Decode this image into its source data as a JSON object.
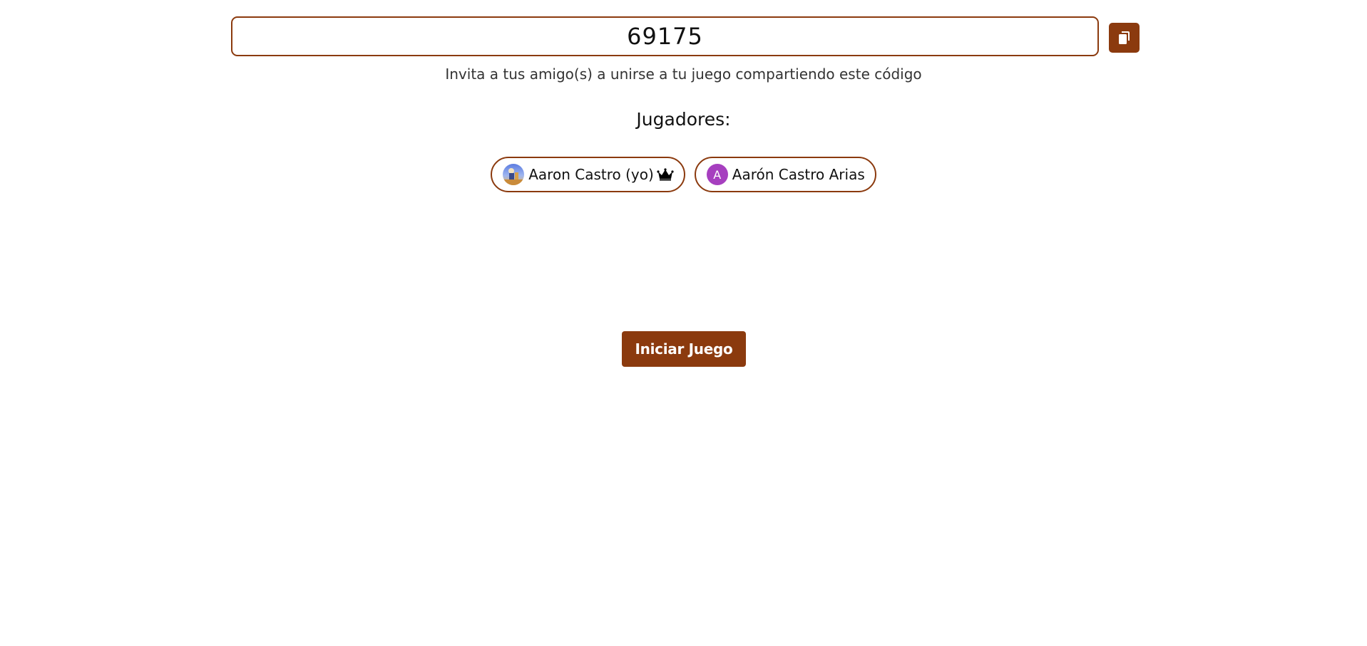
{
  "game_code": {
    "value": "69175",
    "copy_icon": "copy-icon"
  },
  "invite_text": "Invita a tus amigo(s) a unirse a tu juego compartiendo este código",
  "players_title": "Jugadores:",
  "players": [
    {
      "name": "Aaron Castro (yo)",
      "avatar": "photo-avatar",
      "is_host": true,
      "host_icon": "crown-icon"
    },
    {
      "name": "Aarón Castro Arias",
      "avatar_letter": "A",
      "avatar_color": "#A63FBF",
      "is_host": false
    }
  ],
  "start_button": {
    "label": "Iniciar Juego"
  },
  "colors": {
    "accent": "#8B3A0E",
    "background": "#FFFFFF",
    "text": "#111111"
  }
}
